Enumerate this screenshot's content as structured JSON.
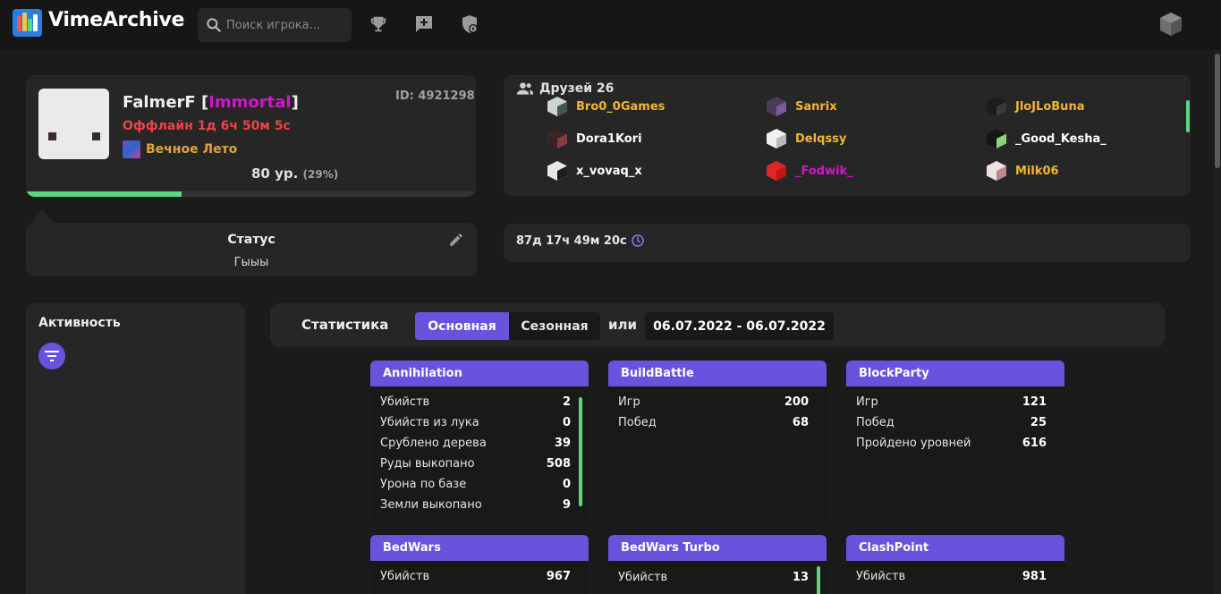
{
  "app": {
    "brand": "VimeArchive"
  },
  "colors": {
    "accent": "#6b52dc",
    "bg": "#1b1b1c",
    "card": "#262627",
    "green": "#5ad87f",
    "rank": "#d316c9",
    "offline": "#ef4149",
    "guild": "#e0a43a"
  },
  "search": {
    "placeholder": "Поиск игрока..."
  },
  "nav": {
    "icons": [
      "trophy-icon",
      "message-plus-icon",
      "shield-lock-icon",
      "user-avatar-icon"
    ]
  },
  "profile": {
    "name": "FalmerF",
    "rank": "Immortal",
    "id_label": "ID: 4921298",
    "offline": "Оффлайн 1д 6ч 50м 5с",
    "guild": "Вечное Лето",
    "level": "80 ур.",
    "level_pct": "(29%)",
    "progress": 0.29
  },
  "status": {
    "title": "Статус",
    "text": "Гыыы"
  },
  "friends": {
    "title": "Друзей 26",
    "items": [
      {
        "name": "Bro0_0Games",
        "color": "#f1b634"
      },
      {
        "name": "Sanrix",
        "color": "#f1b634"
      },
      {
        "name": "JloJLoBuna",
        "color": "#f1b634"
      },
      {
        "name": "Dora1Kori",
        "color": "#ffffff"
      },
      {
        "name": "Delqssy",
        "color": "#f1b634"
      },
      {
        "name": "_Good_Kesha_",
        "color": "#ffffff"
      },
      {
        "name": "x_vovaq_x",
        "color": "#ffffff"
      },
      {
        "name": "_Fodwik_",
        "color": "#d316c9"
      },
      {
        "name": "Milk06",
        "color": "#f1b634"
      }
    ]
  },
  "playtime": {
    "text": "87д 17ч 49м 20с"
  },
  "activity": {
    "title": "Активность"
  },
  "stats": {
    "title": "Статистика",
    "tab_main": "Основная",
    "tab_season": "Сезонная",
    "or": "или",
    "date_range": "06.07.2022 - 06.07.2022"
  },
  "games": [
    {
      "name": "Annihilation",
      "rows": [
        [
          "Убийств",
          "2"
        ],
        [
          "Убийств из лука",
          "0"
        ],
        [
          "Срублено дерева",
          "39"
        ],
        [
          "Руды выкопано",
          "508"
        ],
        [
          "Урона по базе",
          "0"
        ],
        [
          "Земли выкопано",
          "9"
        ]
      ]
    },
    {
      "name": "BuildBattle",
      "rows": [
        [
          "Игр",
          "200"
        ],
        [
          "Побед",
          "68"
        ]
      ]
    },
    {
      "name": "BlockParty",
      "rows": [
        [
          "Игр",
          "121"
        ],
        [
          "Побед",
          "25"
        ],
        [
          "Пройдено уровней",
          "616"
        ]
      ]
    },
    {
      "name": "BedWars",
      "rows": [
        [
          "Убийств",
          "967"
        ]
      ]
    },
    {
      "name": "BedWars Turbo",
      "rows": [
        [
          "Убийств",
          "13"
        ]
      ]
    },
    {
      "name": "ClashPoint",
      "rows": [
        [
          "Убийств",
          "981"
        ]
      ]
    }
  ]
}
